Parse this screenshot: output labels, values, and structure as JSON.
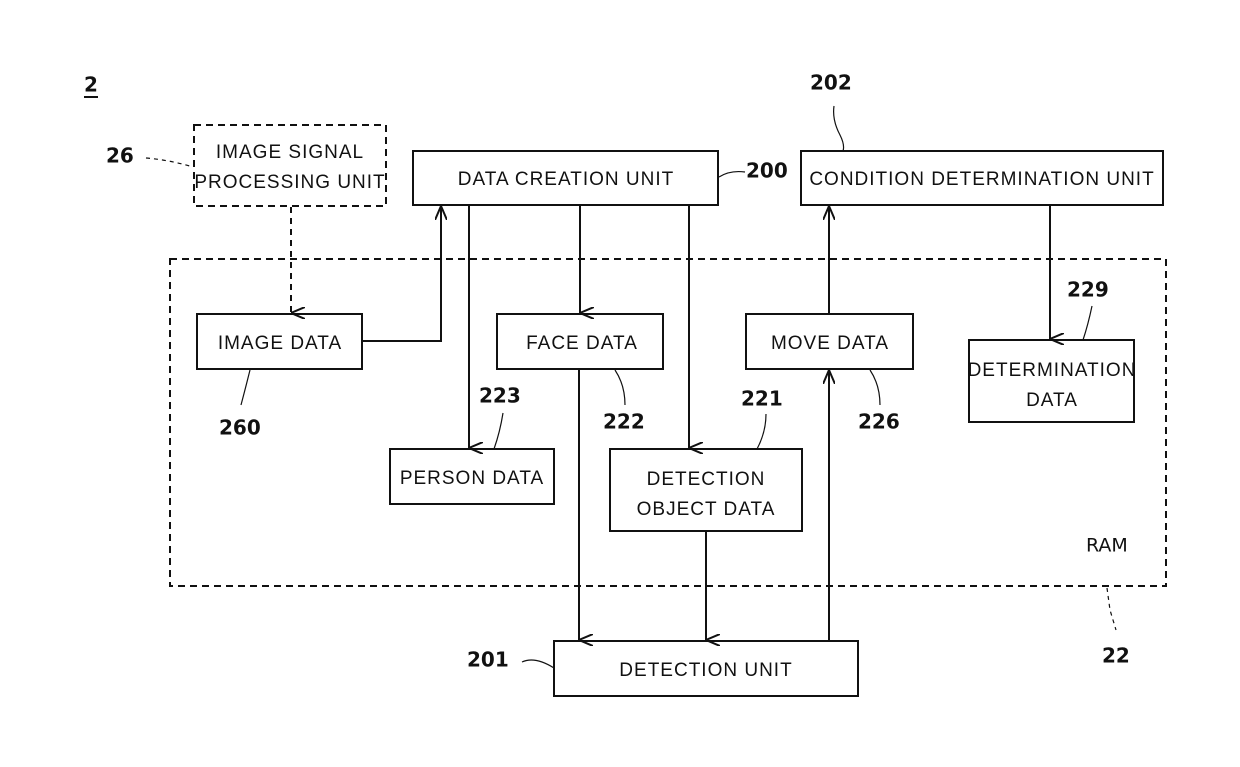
{
  "figure": {
    "number": "2",
    "ram": {
      "label": "RAM",
      "ref": "22"
    },
    "blocks": {
      "image_signal_processing_unit": {
        "lines": [
          "IMAGE SIGNAL",
          "PROCESSING UNIT"
        ],
        "ref": "26"
      },
      "data_creation_unit": {
        "lines": [
          "DATA CREATION UNIT"
        ],
        "ref": "200"
      },
      "condition_determination_unit": {
        "lines": [
          "CONDITION DETERMINATION UNIT"
        ],
        "ref": "202"
      },
      "detection_unit": {
        "lines": [
          "DETECTION UNIT"
        ],
        "ref": "201"
      },
      "image_data": {
        "lines": [
          "IMAGE DATA"
        ],
        "ref": "260"
      },
      "face_data": {
        "lines": [
          "FACE DATA"
        ],
        "ref": "222"
      },
      "move_data": {
        "lines": [
          "MOVE DATA"
        ],
        "ref": "226"
      },
      "determination_data": {
        "lines": [
          "DETERMINATION",
          "DATA"
        ],
        "ref": "229"
      },
      "person_data": {
        "lines": [
          "PERSON DATA"
        ],
        "ref": "223"
      },
      "detection_object_data": {
        "lines": [
          "DETECTION",
          "OBJECT DATA"
        ],
        "ref": "221"
      }
    },
    "connections": [
      {
        "from": "image_signal_processing_unit",
        "to": "image_data",
        "style": "dashed"
      },
      {
        "from": "image_data",
        "to": "data_creation_unit",
        "style": "solid"
      },
      {
        "from": "data_creation_unit",
        "to": "person_data",
        "style": "solid"
      },
      {
        "from": "data_creation_unit",
        "to": "face_data",
        "style": "solid"
      },
      {
        "from": "data_creation_unit",
        "to": "detection_object_data",
        "style": "solid"
      },
      {
        "from": "face_data",
        "to": "detection_unit",
        "style": "solid"
      },
      {
        "from": "detection_object_data",
        "to": "detection_unit",
        "style": "solid"
      },
      {
        "from": "detection_unit",
        "to": "move_data",
        "style": "solid"
      },
      {
        "from": "move_data",
        "to": "condition_determination_unit",
        "style": "solid"
      },
      {
        "from": "condition_determination_unit",
        "to": "determination_data",
        "style": "solid"
      }
    ]
  }
}
